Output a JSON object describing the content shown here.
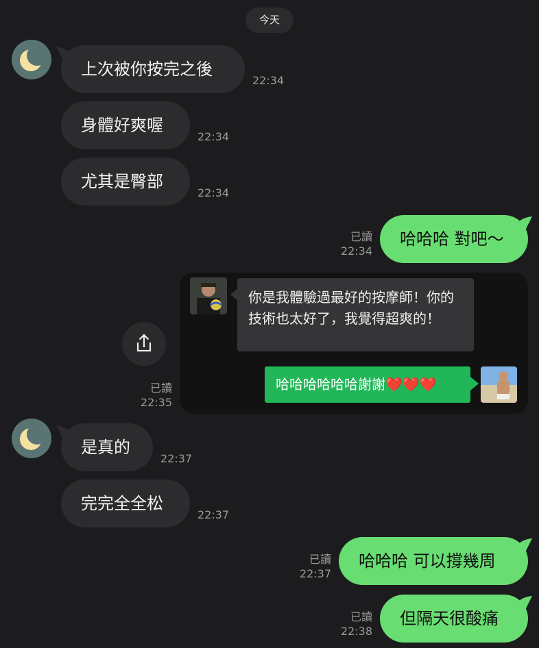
{
  "date_label": "今天",
  "messages": [
    {
      "text": "上次被你按完之後",
      "time": "22:34"
    },
    {
      "text": "身體好爽喔",
      "time": "22:34"
    },
    {
      "text": "尤其是臀部",
      "time": "22:34"
    },
    {
      "text": "哈哈哈 對吧～",
      "read": "已讀",
      "time": "22:34"
    },
    {
      "read": "已讀",
      "time": "22:35"
    },
    {
      "text": "是真的",
      "time": "22:37"
    },
    {
      "text": "完完全全松",
      "time": "22:37"
    },
    {
      "text": "哈哈哈 可以撐幾周",
      "read": "已讀",
      "time": "22:37"
    },
    {
      "text": "但隔天很酸痛",
      "read": "已讀",
      "time": "22:38"
    }
  ],
  "shared_card": {
    "quote_text": "你是我體驗過最好的按摩師！你的技術也太好了，我覺得超爽的！",
    "reply_text": "哈哈哈哈哈哈謝謝",
    "reply_hearts": "❤️❤️❤️"
  },
  "colors": {
    "background": "#1c1c1e",
    "incoming_bubble": "#2c2c2e",
    "outgoing_bubble": "#68dd71",
    "card_reply": "#21b658"
  },
  "icons": {
    "avatar": "moon-icon",
    "share": "share-icon"
  }
}
